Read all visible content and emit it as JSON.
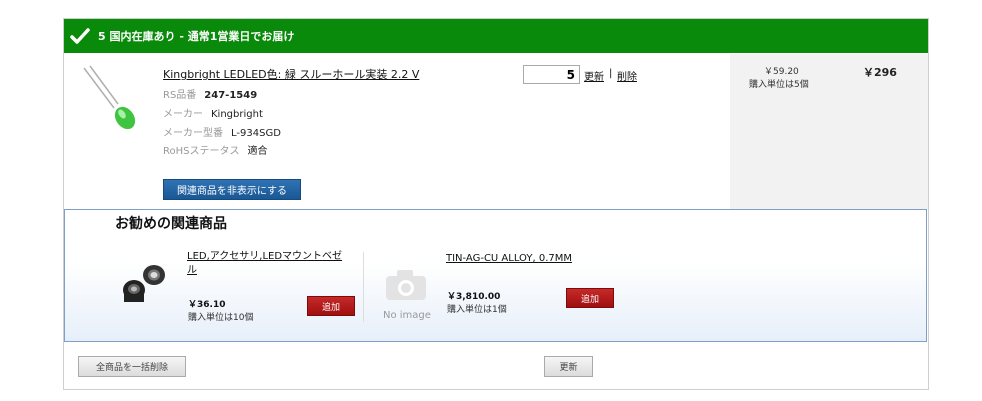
{
  "stock": {
    "label": "5 国内在庫あり - 通常1営業日でお届け"
  },
  "item": {
    "name": "Kingbright LEDLED色: 緑 スルーホール実装 2.2 V",
    "rs_label": "RS品番",
    "rs_value": "247-1549",
    "maker_label": "メーカー",
    "maker_value": "Kingbright",
    "part_label": "メーカー型番",
    "part_value": "L-934SGD",
    "rohs_label": "RoHSステータス",
    "rohs_value": "適合",
    "hide_related_button": "関連商品を非表示にする",
    "quantity": "5",
    "update_link": "更新",
    "separator": "|",
    "delete_link": "削除",
    "unit_price": "￥59.20",
    "unit_note": "購入単位は5個",
    "total": "￥296"
  },
  "related": {
    "title": "お勧めの関連商品",
    "items": [
      {
        "name_line1": "LED,アクセサリ,LEDマウントベゼ",
        "name_line2": "ル",
        "price": "￥36.10",
        "note": "購入単位は10個",
        "add": "追加"
      },
      {
        "name_line1": "TIN-AG-CU ALLOY, 0.7MM",
        "name_line2": "",
        "price": "￥3,810.00",
        "note": "購入単位は1個",
        "add": "追加",
        "no_image": "No image"
      }
    ]
  },
  "footer": {
    "delete_all": "全商品を一括削除",
    "update": "更新"
  },
  "colors": {
    "stock_green": "#0a8a0a",
    "button_blue": "#1a5795",
    "add_red": "#b51a1a"
  }
}
